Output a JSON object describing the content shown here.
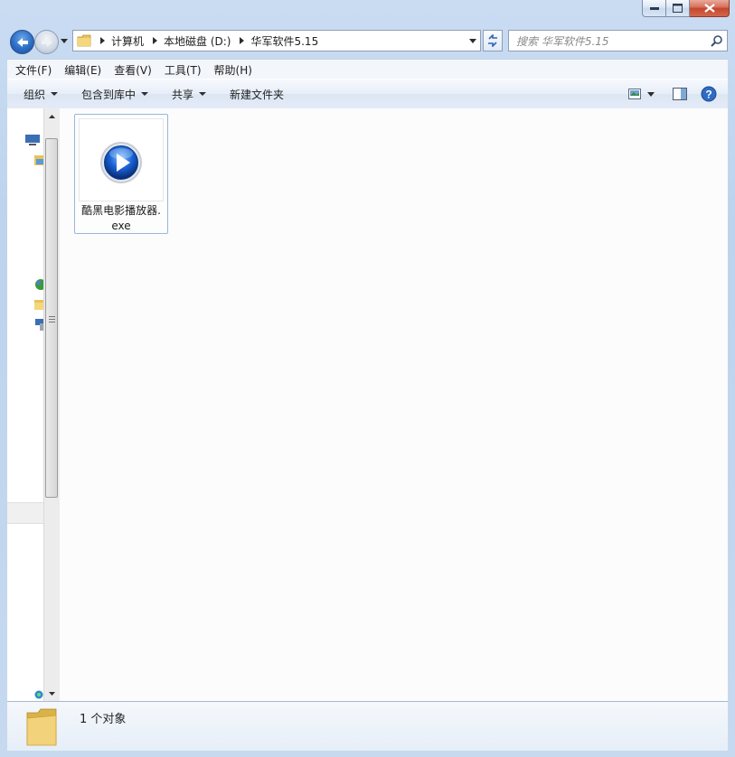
{
  "window": {
    "minimize_glyph": "—",
    "maximize_glyph": "☐",
    "close_glyph": "✕"
  },
  "address": {
    "crumbs": [
      "计算机",
      "本地磁盘 (D:)",
      "华军软件5.15"
    ]
  },
  "search": {
    "placeholder": "搜索 华军软件5.15"
  },
  "menu": {
    "items": [
      "文件(F)",
      "编辑(E)",
      "查看(V)",
      "工具(T)",
      "帮助(H)"
    ]
  },
  "toolbar": {
    "organize": "组织",
    "include_in_library": "包含到库中",
    "share": "共享",
    "new_folder": "新建文件夹"
  },
  "files": [
    {
      "name_line1": "酷黑电影播放器.",
      "name_line2": "exe",
      "icon": "media-player-icon"
    }
  ],
  "status": {
    "count_text": "1 个对象"
  },
  "colors": {
    "frame": "#c9dcf2",
    "content_bg": "#fcfcfd",
    "accent_blue": "#2a6dc6",
    "close_red": "#c4452c"
  }
}
